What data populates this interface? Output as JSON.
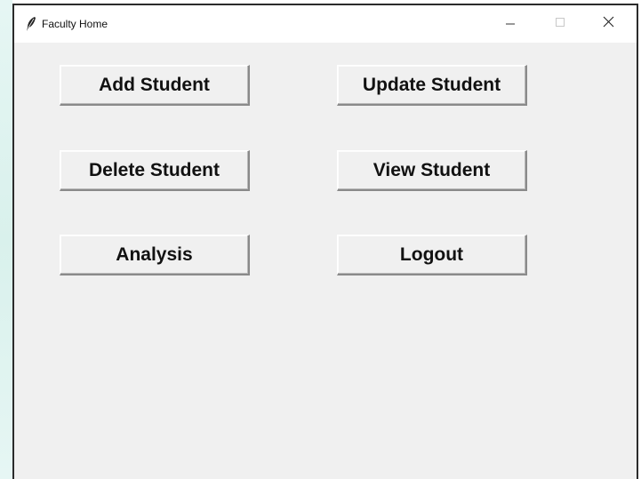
{
  "window": {
    "title": "Faculty Home"
  },
  "title_controls": {
    "minimize_icon": "minimize-icon",
    "maximize_icon": "maximize-icon",
    "close_icon": "close-icon"
  },
  "buttons": {
    "add_student": "Add Student",
    "update_student": "Update Student",
    "delete_student": "Delete Student",
    "view_student": "View Student",
    "analysis": "Analysis",
    "logout": "Logout"
  }
}
